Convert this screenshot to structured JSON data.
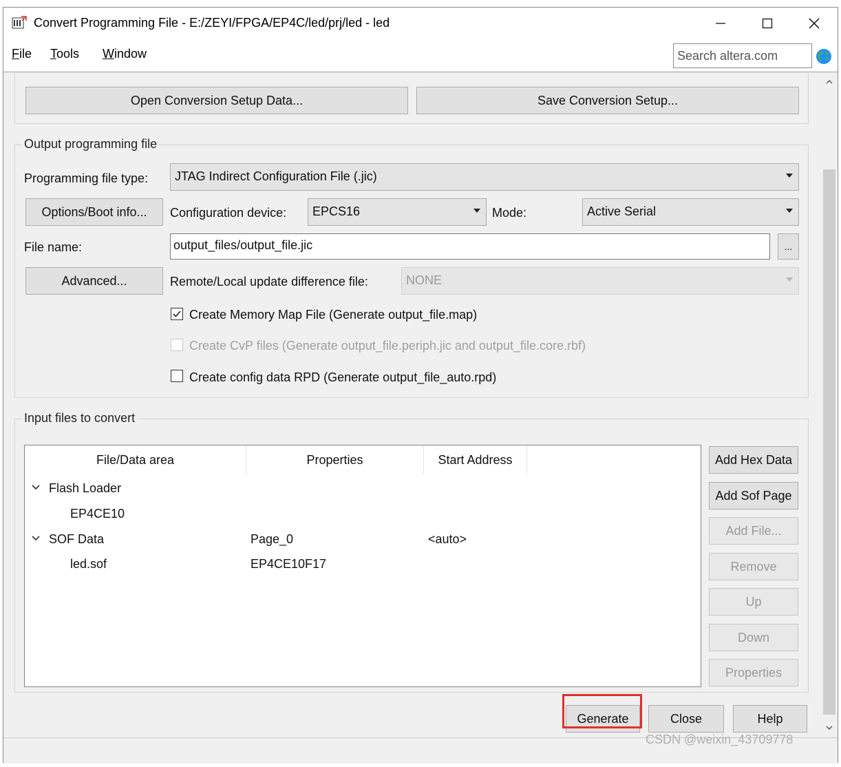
{
  "window": {
    "title": "Convert Programming File - E:/ZEYI/FPGA/EP4C/led/prj/led - led",
    "minimize_icon": "minimize-icon",
    "maximize_icon": "maximize-icon",
    "close_icon": "close-icon"
  },
  "menu": {
    "file": "File",
    "tools": "Tools",
    "window": "Window",
    "search_placeholder": "Search altera.com"
  },
  "setup": {
    "open_button": "Open Conversion Setup Data...",
    "save_button": "Save Conversion Setup..."
  },
  "output": {
    "group_title": "Output programming file",
    "file_type_label": "Programming file type:",
    "file_type_value": "JTAG Indirect Configuration File (.jic)",
    "options_button": "Options/Boot info...",
    "config_device_label": "Configuration device:",
    "config_device_value": "EPCS16",
    "mode_label": "Mode:",
    "mode_value": "Active Serial",
    "file_name_label": "File name:",
    "file_name_value": "output_files/output_file.jic",
    "browse_button": "...",
    "advanced_button": "Advanced...",
    "remote_label": "Remote/Local update difference file:",
    "remote_value": "NONE",
    "check_memory_map": "Create Memory Map File (Generate output_file.map)",
    "check_memory_map_checked": true,
    "check_cvp": "Create CvP files (Generate output_file.periph.jic and output_file.core.rbf)",
    "check_cvp_checked": false,
    "check_rpd": "Create config data RPD (Generate output_file_auto.rpd)",
    "check_rpd_checked": false
  },
  "input": {
    "group_title": "Input files to convert",
    "columns": [
      "File/Data area",
      "Properties",
      "Start Address"
    ],
    "rows": [
      {
        "name": "Flash Loader",
        "properties": "",
        "start": "",
        "expanded": true,
        "level": 0
      },
      {
        "name": "EP4CE10",
        "properties": "",
        "start": "",
        "level": 1
      },
      {
        "name": "SOF Data",
        "properties": "Page_0",
        "start": "<auto>",
        "expanded": true,
        "level": 0
      },
      {
        "name": "led.sof",
        "properties": "EP4CE10F17",
        "start": "",
        "level": 1
      }
    ],
    "side_buttons": {
      "add_hex": "Add Hex Data",
      "add_sof": "Add Sof Page",
      "add_file": "Add File...",
      "remove": "Remove",
      "up": "Up",
      "down": "Down",
      "properties": "Properties"
    }
  },
  "footer": {
    "generate": "Generate",
    "close": "Close",
    "help": "Help"
  },
  "watermark": "CSDN @weixin_43709778",
  "colors": {
    "highlight": "#e0312c",
    "window_bg": "#f0f0f0"
  }
}
